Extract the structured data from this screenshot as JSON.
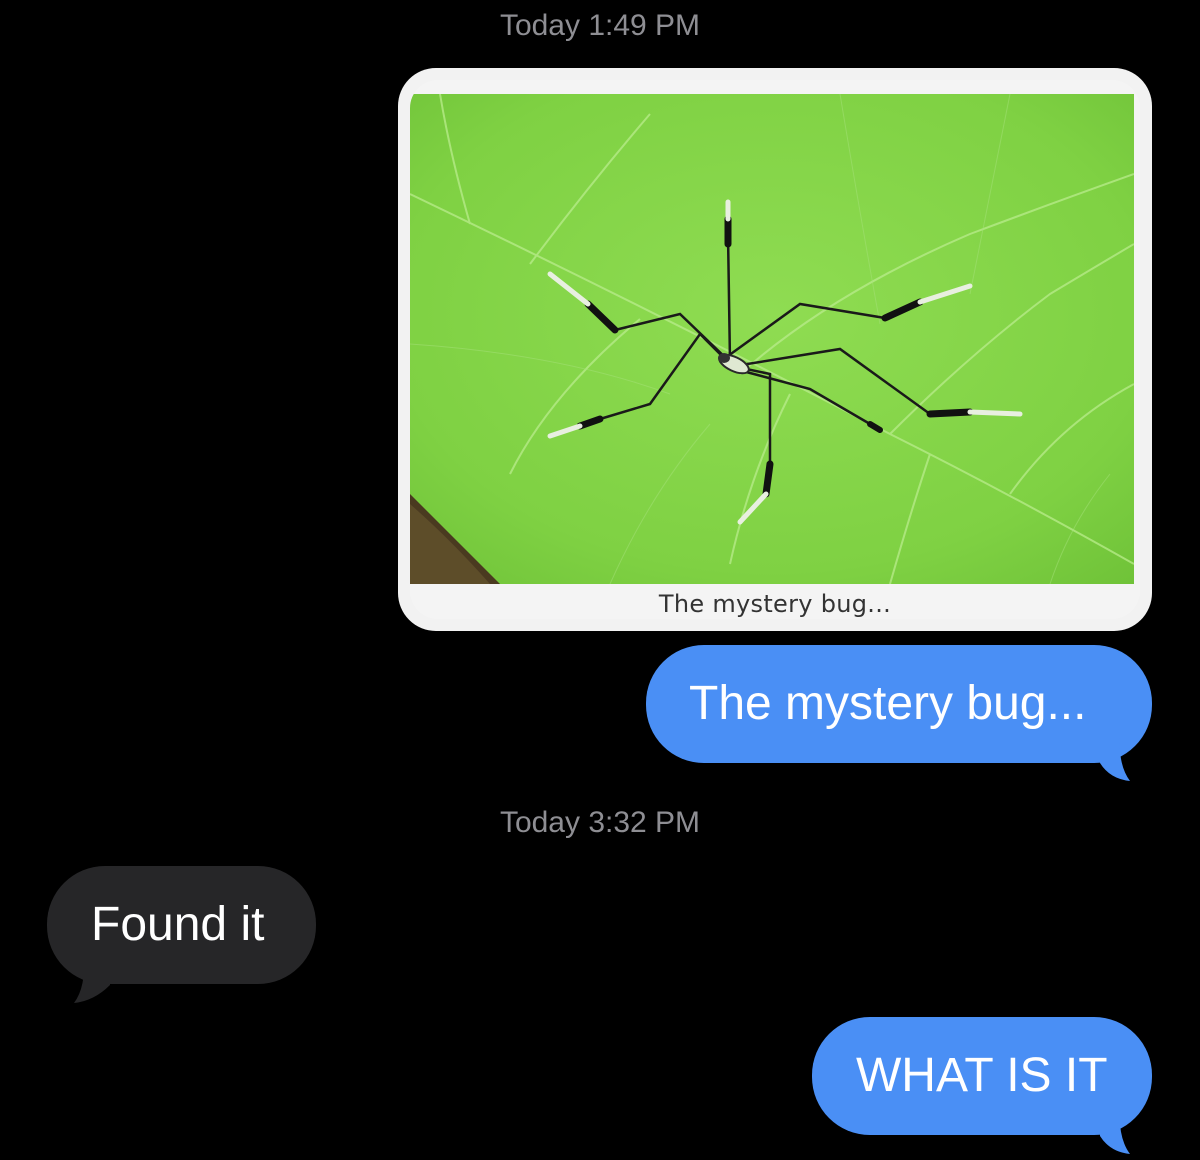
{
  "thread": {
    "timestamp_1": "Today 1:49 PM",
    "timestamp_2": "Today 3:32 PM"
  },
  "messages": [
    {
      "direction": "sent",
      "type": "image",
      "caption": "The mystery bug..."
    },
    {
      "direction": "sent",
      "type": "text",
      "text": "The mystery bug..."
    },
    {
      "direction": "received",
      "type": "text",
      "text": "Found it"
    },
    {
      "direction": "sent",
      "type": "text",
      "text": "WHAT IS IT"
    }
  ],
  "colors": {
    "background": "#000000",
    "sent_bubble": "#4a8ff5",
    "received_bubble": "#262628",
    "timestamp": "#8e8e93",
    "leaf_green": "#86d94a"
  }
}
